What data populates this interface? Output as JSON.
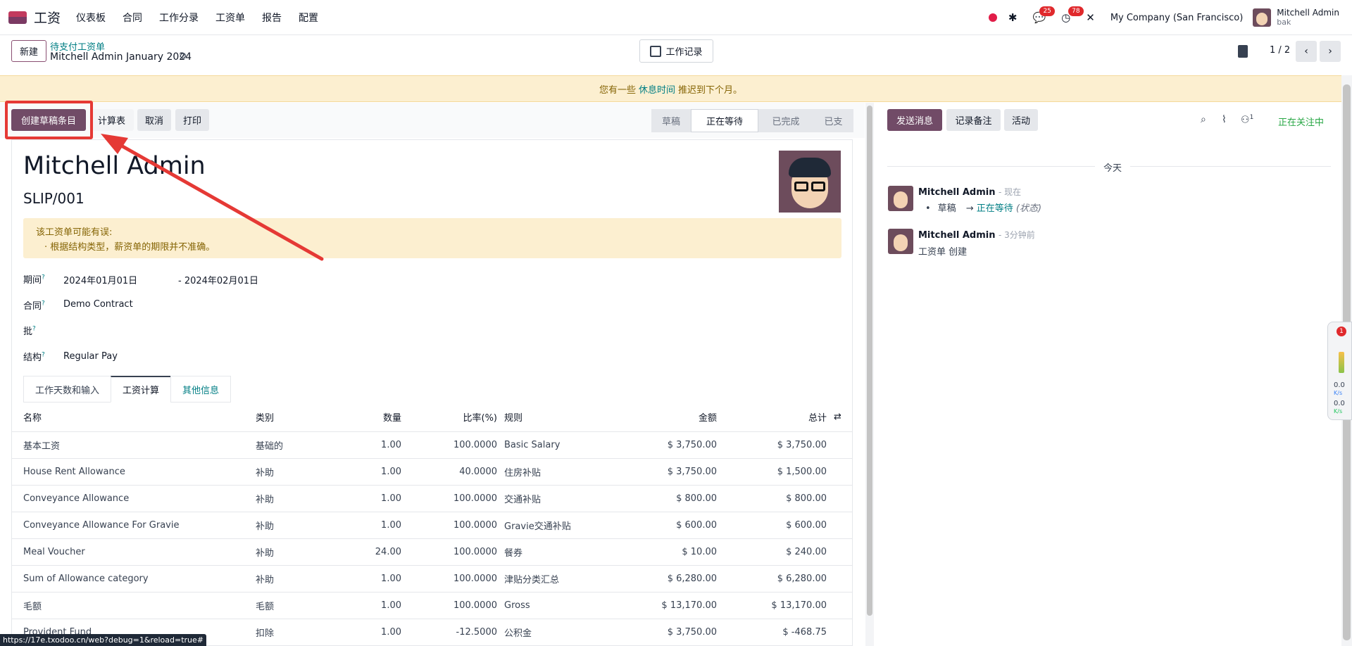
{
  "app": {
    "name": "工资"
  },
  "menu": [
    "仪表板",
    "合同",
    "工作分录",
    "工资单",
    "报告",
    "配置"
  ],
  "topbar": {
    "chat_count": "25",
    "activity_count": "78",
    "company": "My Company (San Francisco)",
    "user_name": "Mitchell Admin",
    "user_db": "bak"
  },
  "control": {
    "new_label": "新建",
    "breadcrumb": "待支付工资单",
    "record": "Mitchell Admin January 2024",
    "worklog_label": "工作记录",
    "pager": "1 / 2"
  },
  "alert": {
    "prefix": "您有一些",
    "link": "休息时间",
    "suffix": "推迟到下个月。"
  },
  "actions": [
    "创建草稿条目",
    "计算表",
    "取消",
    "打印"
  ],
  "stages": [
    "草稿",
    "正在等待",
    "已完成",
    "已支"
  ],
  "employee": {
    "name": "Mitchell Admin",
    "slip": "SLIP/001"
  },
  "warning": {
    "title": "该工资单可能有误:",
    "item": "· 根据结构类型，薪资单的期限并不准确。"
  },
  "fields": {
    "period_label": "期间",
    "period_from": "2024年01月01日",
    "period_to": "- 2024年02月01日",
    "contract_label": "合同",
    "contract": "Demo Contract",
    "batch_label": "批",
    "structure_label": "结构",
    "structure": "Regular Pay",
    "help": "?"
  },
  "tabs": [
    "工作天数和输入",
    "工资计算",
    "其他信息"
  ],
  "table": {
    "headers": [
      "名称",
      "类别",
      "数量",
      "比率(%)",
      "规则",
      "金额",
      "总计"
    ],
    "rows": [
      [
        "基本工资",
        "基础的",
        "1.00",
        "100.0000",
        "Basic Salary",
        "$ 3,750.00",
        "$ 3,750.00"
      ],
      [
        "House Rent Allowance",
        "补助",
        "1.00",
        "40.0000",
        "住房补贴",
        "$ 3,750.00",
        "$ 1,500.00"
      ],
      [
        "Conveyance Allowance",
        "补助",
        "1.00",
        "100.0000",
        "交通补贴",
        "$ 800.00",
        "$ 800.00"
      ],
      [
        "Conveyance Allowance For Gravie",
        "补助",
        "1.00",
        "100.0000",
        "Gravie交通补贴",
        "$ 600.00",
        "$ 600.00"
      ],
      [
        "Meal Voucher",
        "补助",
        "24.00",
        "100.0000",
        "餐券",
        "$ 10.00",
        "$ 240.00"
      ],
      [
        "Sum of Allowance category",
        "补助",
        "1.00",
        "100.0000",
        "津贴分类汇总",
        "$ 6,280.00",
        "$ 6,280.00"
      ],
      [
        "毛额",
        "毛额",
        "1.00",
        "100.0000",
        "Gross",
        "$ 13,170.00",
        "$ 13,170.00"
      ],
      [
        "Provident Fund",
        "扣除",
        "1.00",
        "-12.5000",
        "公积金",
        "$ 3,750.00",
        "$ -468.75"
      ]
    ]
  },
  "chatter": {
    "send": "发送消息",
    "note": "记录备注",
    "activity": "活动",
    "follower_count": "1",
    "following": "正在关注中",
    "today": "今天",
    "messages": [
      {
        "author": "Mitchell Admin",
        "time": "- 现在",
        "from": "草稿",
        "to": "正在等待",
        "note": "(状态)"
      },
      {
        "author": "Mitchell Admin",
        "time": "- 3分钟前",
        "body": "工资单 创建"
      }
    ]
  },
  "widget": {
    "badge": "1",
    "up": "0.0",
    "down": "0.0",
    "unit": "K/s"
  },
  "status_url": "https://17e.txodoo.cn/web?debug=1&reload=true#"
}
